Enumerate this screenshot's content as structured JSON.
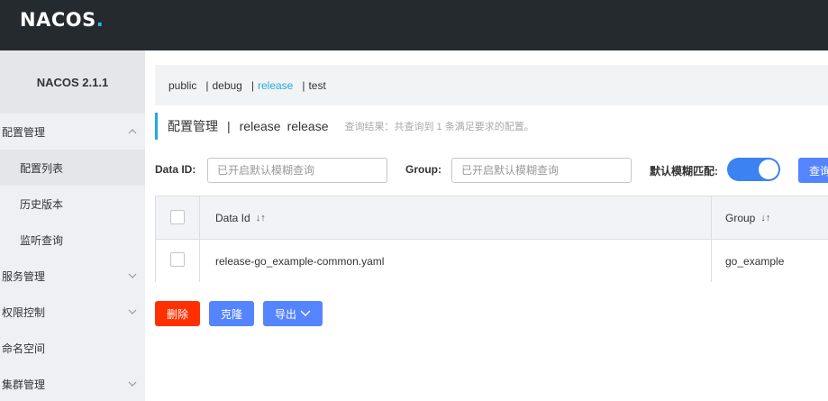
{
  "header": {
    "logo_main": "NACOS",
    "logo_dot": "."
  },
  "sidebar": {
    "version": "NACOS 2.1.1",
    "items": [
      {
        "label": "配置管理",
        "type": "group",
        "expanded": true
      },
      {
        "label": "配置列表",
        "type": "sub",
        "active": true
      },
      {
        "label": "历史版本",
        "type": "sub"
      },
      {
        "label": "监听查询",
        "type": "sub"
      },
      {
        "label": "服务管理",
        "type": "group"
      },
      {
        "label": "权限控制",
        "type": "group"
      },
      {
        "label": "命名空间",
        "type": "plain"
      },
      {
        "label": "集群管理",
        "type": "group"
      }
    ]
  },
  "namespaces": {
    "items": [
      "public",
      "debug",
      "release",
      "test"
    ],
    "separator": "|",
    "active": "release"
  },
  "title": {
    "main": "配置管理",
    "sep": "|",
    "ns_name": "release",
    "ns_id": "release",
    "result": "查询结果：共查询到 1 条满足要求的配置。"
  },
  "filters": {
    "dataid_label": "Data ID:",
    "dataid_placeholder": "已开启默认模糊查询",
    "group_label": "Group:",
    "group_placeholder": "已开启默认模糊查询",
    "fuzzy_label": "默认模糊匹配:",
    "fuzzy_on": true,
    "search_label": "查询"
  },
  "table": {
    "columns": [
      "Data Id",
      "Group"
    ],
    "rows": [
      {
        "data_id": "release-go_example-common.yaml",
        "group": "go_example"
      }
    ]
  },
  "actions": {
    "delete": "删除",
    "clone": "克隆",
    "export": "导出"
  },
  "colors": {
    "header_bg": "#252a2f",
    "accent": "#22aadd",
    "primary": "#5584ff",
    "danger": "#ff3000",
    "toggle": "#3c82f0"
  }
}
